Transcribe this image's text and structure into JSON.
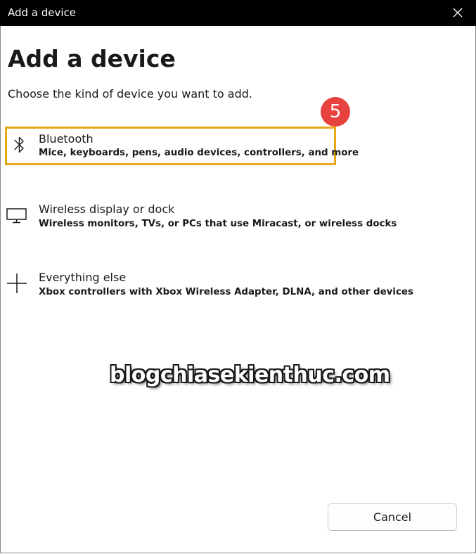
{
  "window": {
    "title": "Add a device"
  },
  "page": {
    "heading": "Add a device",
    "subtitle": "Choose the kind of device you want to add."
  },
  "options": [
    {
      "title": "Bluetooth",
      "description": "Mice, keyboards, pens, audio devices, controllers, and more",
      "icon": "bluetooth-icon"
    },
    {
      "title": "Wireless display or dock",
      "description": "Wireless monitors, TVs, or PCs that use Miracast, or wireless docks",
      "icon": "monitor-icon"
    },
    {
      "title": "Everything else",
      "description": "Xbox controllers with Xbox Wireless Adapter, DLNA, and other devices",
      "icon": "plus-icon"
    }
  ],
  "annotation": {
    "step_number": "5",
    "badge_color": "#e8423f",
    "highlight_color": "#e6a817"
  },
  "watermark": {
    "text": "blogchiasekienthuc.com"
  },
  "footer": {
    "cancel_label": "Cancel"
  }
}
